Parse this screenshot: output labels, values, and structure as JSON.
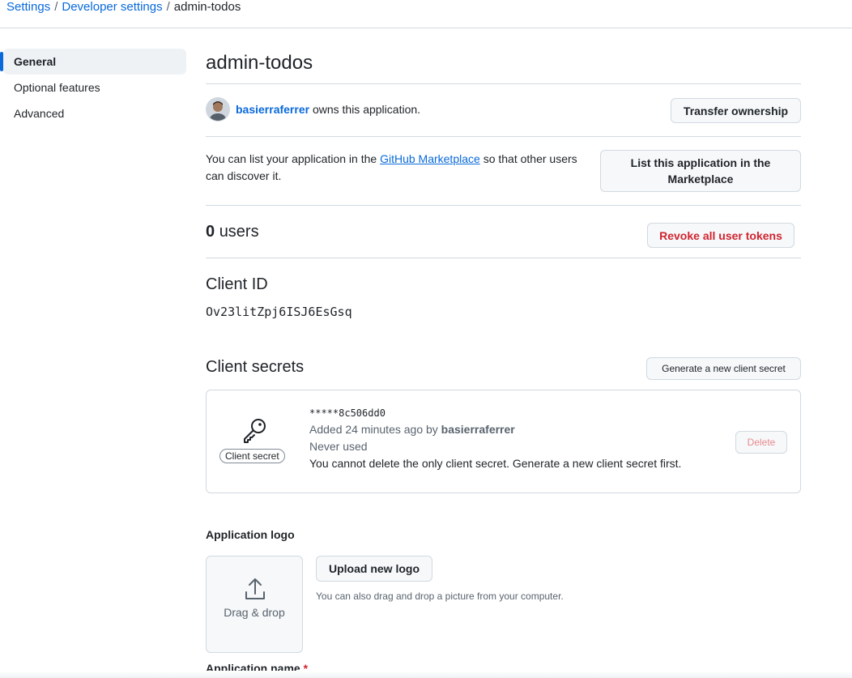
{
  "breadcrumb": {
    "items": [
      "Settings",
      "Developer settings"
    ],
    "current": "admin-todos"
  },
  "sidebar": {
    "items": [
      {
        "label": "General",
        "active": true
      },
      {
        "label": "Optional features"
      },
      {
        "label": "Advanced"
      }
    ]
  },
  "app": {
    "title": "admin-todos"
  },
  "owner": {
    "username": "basierraferrer",
    "suffix": "owns this application.",
    "transfer_label": "Transfer ownership"
  },
  "marketplace": {
    "text_before": "You can list your application in the",
    "link": "GitHub Marketplace",
    "text_after": "so that other users can discover it.",
    "button_label_line1": "List this application in the",
    "button_label_line2": "Marketplace"
  },
  "users": {
    "count": "0",
    "label": "users",
    "revoke_label": "Revoke all user tokens"
  },
  "client_id": {
    "heading": "Client ID",
    "value": "Ov23litZpj6ISJ6EsGsq"
  },
  "client_secrets": {
    "heading": "Client secrets",
    "generate_label": "Generate a new client secret",
    "secret": {
      "badge": "Client secret",
      "masked": "*****8c506dd0",
      "added_prefix": "Added 24 minutes ago by",
      "added_by": "basierraferrer",
      "usage": "Never used",
      "note": "You cannot delete the only client secret. Generate a new client secret first.",
      "delete_label": "Delete"
    }
  },
  "logo": {
    "heading": "Application logo",
    "dropzone_label": "Drag & drop",
    "upload_label": "Upload new logo",
    "hint": "You can also drag and drop a picture from your computer."
  },
  "name": {
    "heading": "Application name",
    "required_mark": "*"
  },
  "colors": {
    "accent": "#0969da",
    "danger": "#d1242f"
  },
  "icons": {
    "secret": "key-icon",
    "dropzone": "upload-icon",
    "avatar": "user-avatar"
  }
}
